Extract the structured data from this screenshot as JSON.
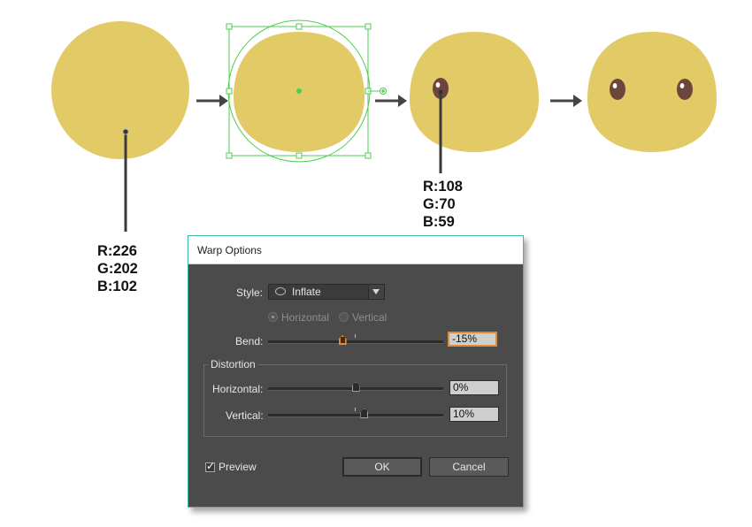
{
  "colors": {
    "body_fill": "#e2ca66",
    "eye_fill": "#6c463b",
    "selection": "#4ccd4c",
    "dialog_bg": "#4b4b4b",
    "dialog_border": "#3fb6a8",
    "focus_accent": "#e08a3c"
  },
  "annotations": {
    "body_color": {
      "r": "R:226",
      "g": "G:202",
      "b": "B:102"
    },
    "eye_color": {
      "r": "R:108",
      "g": "G:70",
      "b": "B:59"
    }
  },
  "icons": {
    "step_arrow": "arrow-right-icon",
    "style_shape": "ellipse-icon",
    "dropdown": "chevron-down-icon",
    "preview_check": "checkmark-icon"
  },
  "dialog": {
    "title": "Warp Options",
    "style_label": "Style:",
    "style_value": "Inflate",
    "orientation": {
      "horizontal_label": "Horizontal",
      "vertical_label": "Vertical",
      "selected": "Horizontal"
    },
    "bend": {
      "label": "Bend:",
      "value": "-15%",
      "percent": -15
    },
    "distortion": {
      "title": "Distortion",
      "horizontal": {
        "label": "Horizontal:",
        "value": "0%",
        "percent": 0
      },
      "vertical": {
        "label": "Vertical:",
        "value": "10%",
        "percent": 10
      }
    },
    "preview_label": "Preview",
    "preview_checked": true,
    "ok_label": "OK",
    "cancel_label": "Cancel"
  }
}
